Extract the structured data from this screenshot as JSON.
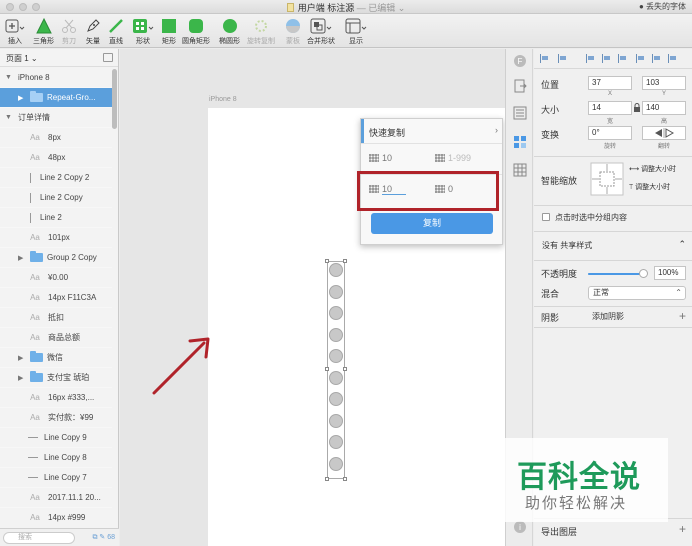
{
  "window": {
    "title": "用户端 标注源",
    "subtitle": "— 已编辑 ⌄",
    "topright": "丢失的字体"
  },
  "toolbar": {
    "items": [
      {
        "label": "插入",
        "icon": "plus-icon"
      },
      {
        "label": "三角形",
        "icon": "triangle-icon"
      },
      {
        "label": "剪刀",
        "icon": "scissors-icon"
      },
      {
        "label": "矢量",
        "icon": "pen-icon"
      },
      {
        "label": "直线",
        "icon": "line-icon"
      },
      {
        "label": "形状",
        "icon": "shapes-icon"
      },
      {
        "label": "矩形",
        "icon": "rectangle-icon"
      },
      {
        "label": "圆角矩形",
        "icon": "rounded-rectangle-icon"
      },
      {
        "label": "椭圆形",
        "icon": "ellipse-icon"
      },
      {
        "label": "旋转复制",
        "icon": "rotate-copy-icon"
      },
      {
        "label": "蒙板",
        "icon": "mask-icon"
      },
      {
        "label": "合并形状",
        "icon": "combine-icon"
      },
      {
        "label": "显示",
        "icon": "view-icon"
      }
    ]
  },
  "leftpanel": {
    "page_selector": "页面 1 ⌄",
    "layers": [
      {
        "label": "iPhone 8",
        "kind": "artboard"
      },
      {
        "label": "Repeat-Gro...",
        "kind": "group"
      },
      {
        "label": "订单详情",
        "kind": "artboard"
      },
      {
        "label": "8px",
        "kind": "text"
      },
      {
        "label": "48px",
        "kind": "text"
      },
      {
        "label": "Line 2 Copy 2",
        "kind": "vline"
      },
      {
        "label": "Line 2 Copy",
        "kind": "vline"
      },
      {
        "label": "Line 2",
        "kind": "vline"
      },
      {
        "label": "101px",
        "kind": "text"
      },
      {
        "label": "Group 2 Copy",
        "kind": "group"
      },
      {
        "label": "¥0.00",
        "kind": "text"
      },
      {
        "label": "14px F11C3A",
        "kind": "text"
      },
      {
        "label": "抵扣",
        "kind": "text"
      },
      {
        "label": "商品总额",
        "kind": "text"
      },
      {
        "label": "微信",
        "kind": "group"
      },
      {
        "label": "支付宝 琥珀",
        "kind": "group"
      },
      {
        "label": "16px #333,...",
        "kind": "text"
      },
      {
        "label": "实付款：¥99",
        "kind": "text"
      },
      {
        "label": "Line Copy 9",
        "kind": "hline"
      },
      {
        "label": "Line Copy 8",
        "kind": "hline"
      },
      {
        "label": "Line Copy 7",
        "kind": "hline"
      },
      {
        "label": "2017.11.1 20...",
        "kind": "text"
      },
      {
        "label": "14px #999",
        "kind": "text"
      }
    ],
    "text_type": "Aa",
    "search_placeholder": "搜索",
    "count": "68"
  },
  "canvas": {
    "artboard_label": "iPhone 8"
  },
  "popup": {
    "title": "快速复制",
    "chevron": "›",
    "row1_left": "10",
    "row1_right": "1-999",
    "row2_left": "10",
    "row2_right": "0",
    "button": "复制"
  },
  "inspector": {
    "position_label": "位置",
    "x": "37",
    "y": "103",
    "x_label": "X",
    "y_label": "Y",
    "size_label": "大小",
    "width": "14",
    "height": "140",
    "width_label": "宽",
    "height_label": "高",
    "transform_label": "变换",
    "rotation": "0°",
    "rotation_label": "旋转",
    "flip_label": "翻转",
    "smart_scale_label": "智能缩放",
    "adjust_width": "调整大小时",
    "adjust_height": "调整大小时",
    "group_select_label": "点击时选中分组内容",
    "shared_style": "没有 共享样式",
    "opacity_label": "不透明度",
    "opacity_value": "100%",
    "opacity": 1.0,
    "blend_label": "混合",
    "blend_value": "正常",
    "shadow_label": "阴影",
    "add_shadow": "添加阴影",
    "export_label": "导出图层"
  },
  "watermark": {
    "title": "百科全说",
    "subtitle": "助你轻松解决"
  },
  "colors": {
    "accent": "#4a98e5",
    "selection": "#5b9fdc",
    "highlight_box": "#b0232a",
    "arrow": "#b0232a",
    "shape_green": "#3bb64a",
    "watermark_green": "#1e9a5a"
  }
}
